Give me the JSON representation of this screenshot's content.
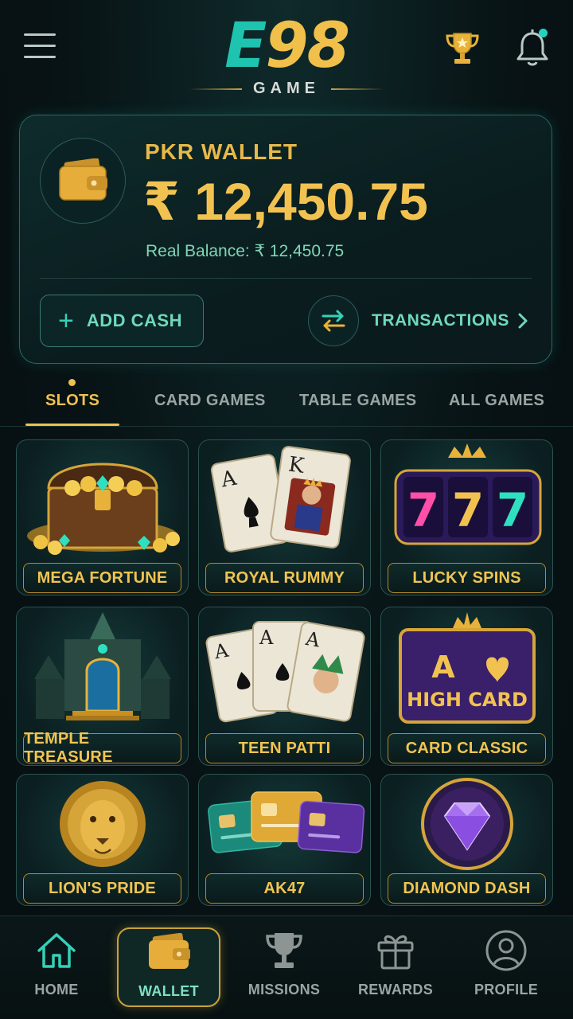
{
  "header": {
    "logo_mark_e": "E",
    "logo_mark_num": "98",
    "logo_sub": "GAME",
    "menu_icon": "hamburger-menu-icon",
    "trophy_icon": "trophy-icon",
    "bell_icon": "bell-icon",
    "has_notification": true
  },
  "wallet": {
    "label": "PKR WALLET",
    "amount": "₹ 12,450.75",
    "real_balance": "Real Balance: ₹ 12,450.75",
    "add_cash_label": "ADD CASH",
    "transactions_label": "TRANSACTIONS",
    "icon": "wallet-icon"
  },
  "tabs": [
    {
      "label": "SLOTS",
      "active": true
    },
    {
      "label": "CARD GAMES",
      "active": false
    },
    {
      "label": "TABLE GAMES",
      "active": false
    },
    {
      "label": "ALL GAMES",
      "active": false
    }
  ],
  "games": [
    {
      "name": "MEGA FORTUNE",
      "art": "treasure-chest"
    },
    {
      "name": "ROYAL RUMMY",
      "art": "playing-cards-king"
    },
    {
      "name": "LUCKY SPINS",
      "art": "slot-777"
    },
    {
      "name": "TEMPLE TREASURE",
      "art": "temple"
    },
    {
      "name": "TEEN PATTI",
      "art": "playing-cards-joker"
    },
    {
      "name": "CARD CLASSIC",
      "art": "high-card"
    },
    {
      "name": "LION'S PRIDE",
      "art": "lion"
    },
    {
      "name": "AK47",
      "art": "credit-cards"
    },
    {
      "name": "DIAMOND DASH",
      "art": "diamond"
    }
  ],
  "art_text": {
    "ace": "A",
    "king": "K",
    "seven": "7",
    "high_card_ace": "A",
    "high_card_label": "HIGH CARD"
  },
  "bottom_nav": [
    {
      "label": "HOME",
      "icon": "home-icon",
      "active": false
    },
    {
      "label": "WALLET",
      "icon": "wallet-icon",
      "active": true
    },
    {
      "label": "MISSIONS",
      "icon": "trophy-icon",
      "active": false
    },
    {
      "label": "REWARDS",
      "icon": "gift-icon",
      "active": false
    },
    {
      "label": "PROFILE",
      "icon": "user-icon",
      "active": false
    }
  ],
  "colors": {
    "accent_gold": "#f2c251",
    "accent_teal": "#1fc4b0",
    "background": "#081315"
  }
}
